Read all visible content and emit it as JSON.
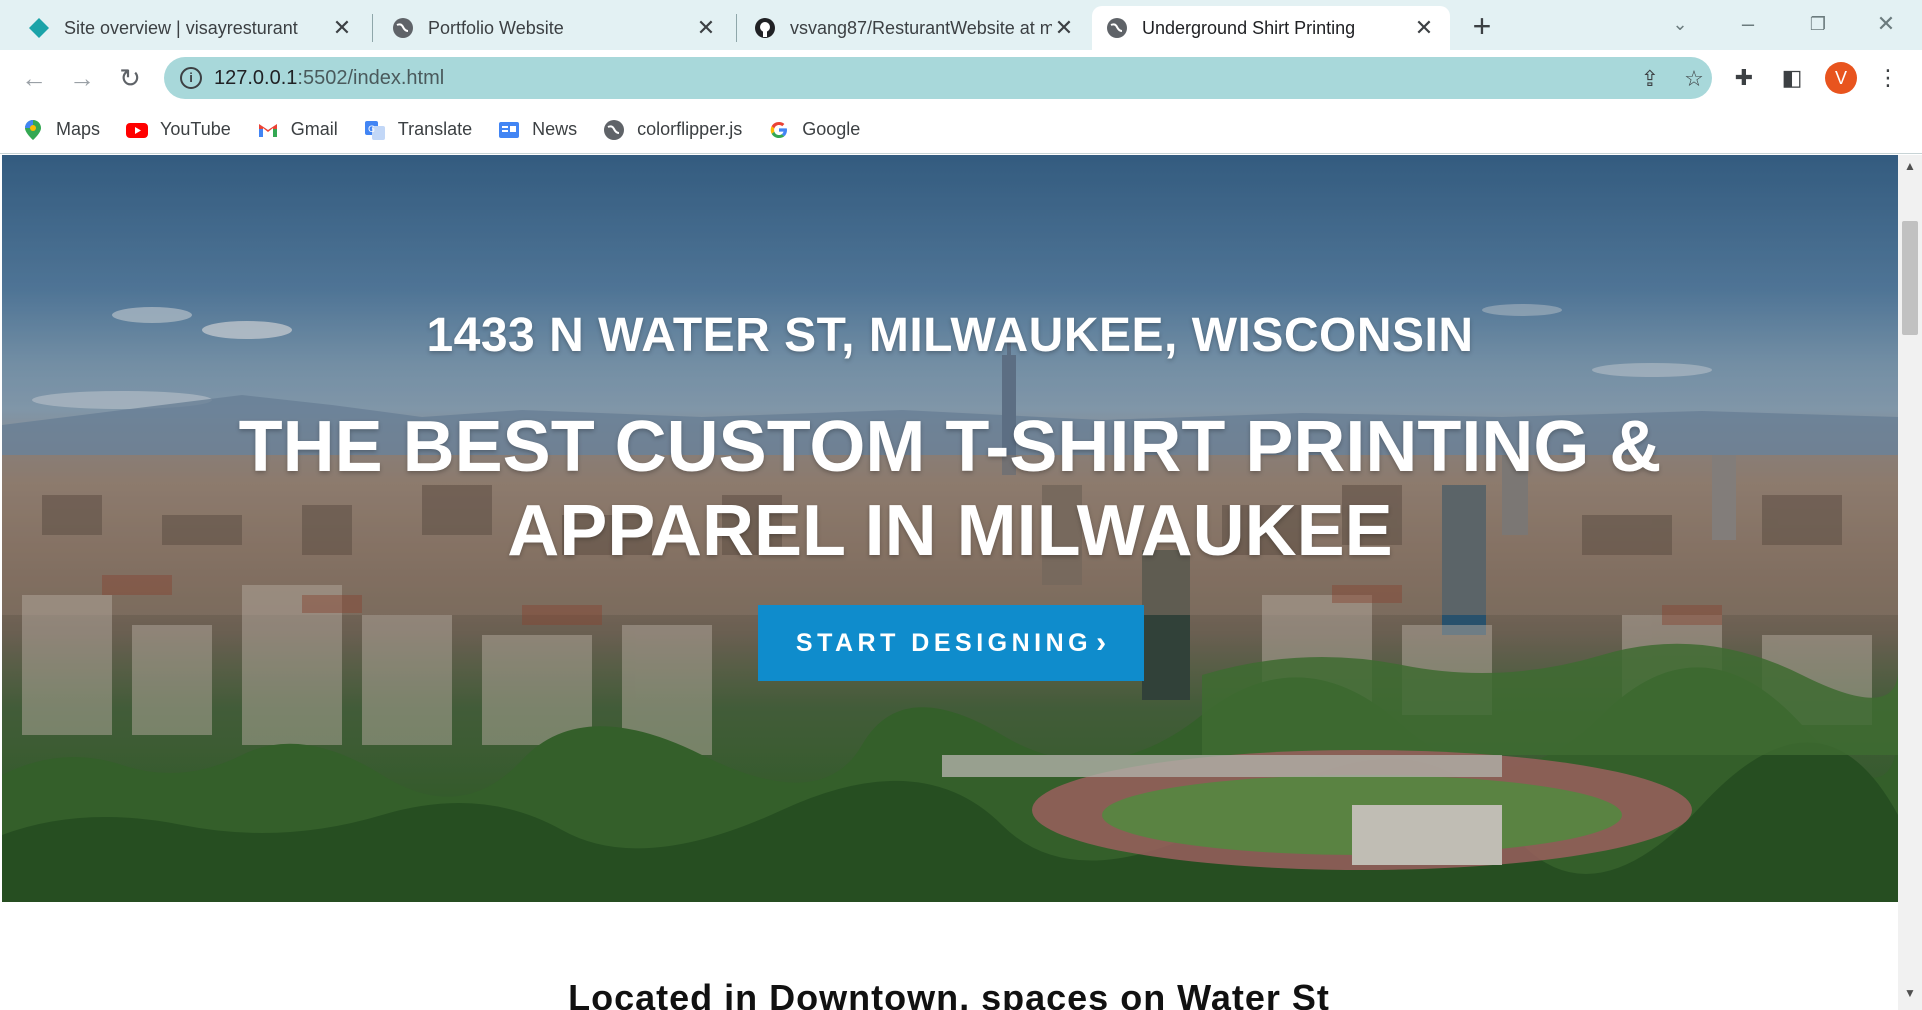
{
  "browser": {
    "tabs": [
      {
        "title": "Site overview | visayresturant",
        "icon": "netlify-diamond-icon",
        "active": false
      },
      {
        "title": "Portfolio Website",
        "icon": "globe-icon",
        "active": false
      },
      {
        "title": "vsvang87/ResturantWebsite at m",
        "icon": "github-icon",
        "active": false
      },
      {
        "title": "Underground Shirt Printing",
        "icon": "globe-icon",
        "active": true
      }
    ],
    "new_tab": "+",
    "url_host": "127.0.0.1",
    "url_path": ":5502/index.html",
    "profile_initial": "V",
    "accent_color": "#a8d8da"
  },
  "bookmarks": [
    {
      "label": "Maps",
      "icon": "maps-pin-icon"
    },
    {
      "label": "YouTube",
      "icon": "youtube-icon"
    },
    {
      "label": "Gmail",
      "icon": "gmail-icon"
    },
    {
      "label": "Translate",
      "icon": "translate-icon"
    },
    {
      "label": "News",
      "icon": "news-icon"
    },
    {
      "label": "colorflipper.js",
      "icon": "globe-icon"
    },
    {
      "label": "Google",
      "icon": "google-icon"
    }
  ],
  "hero": {
    "address": "1433 N WATER ST, MILWAUKEE, WISCONSIN",
    "headline_line1": "THE BEST CUSTOM T-SHIRT PRINTING &",
    "headline_line2": "APPAREL IN MILWAUKEE",
    "cta_label": "START DESIGNING",
    "cta_color": "#0f8ccc"
  },
  "section": {
    "heading": "Located in Downtown, spaces on Water St"
  }
}
